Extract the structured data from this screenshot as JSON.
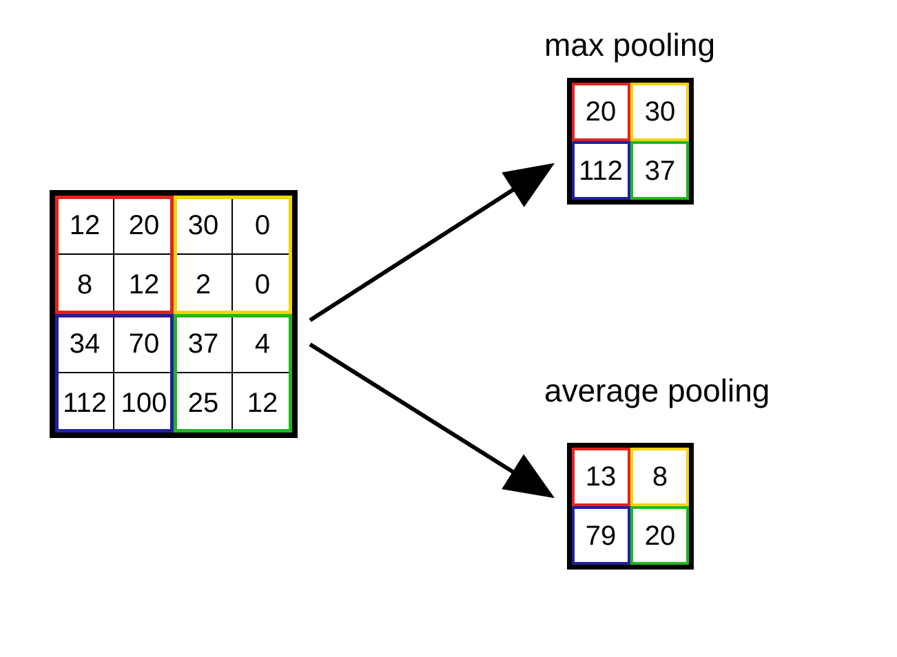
{
  "labels": {
    "max": "max pooling",
    "avg": "average pooling"
  },
  "input": {
    "cells": [
      [
        "12",
        "20",
        "30",
        "0"
      ],
      [
        "8",
        "12",
        "2",
        "0"
      ],
      [
        "34",
        "70",
        "37",
        "4"
      ],
      [
        "112",
        "100",
        "25",
        "12"
      ]
    ]
  },
  "max_out": {
    "cells": [
      [
        "20",
        "30"
      ],
      [
        "112",
        "37"
      ]
    ]
  },
  "avg_out": {
    "cells": [
      [
        "13",
        "8"
      ],
      [
        "79",
        "20"
      ]
    ]
  },
  "colors": {
    "red": "#e2231a",
    "yellow": "#f3d500",
    "blue": "#2020a0",
    "green": "#1fb81f",
    "black": "#000000"
  }
}
